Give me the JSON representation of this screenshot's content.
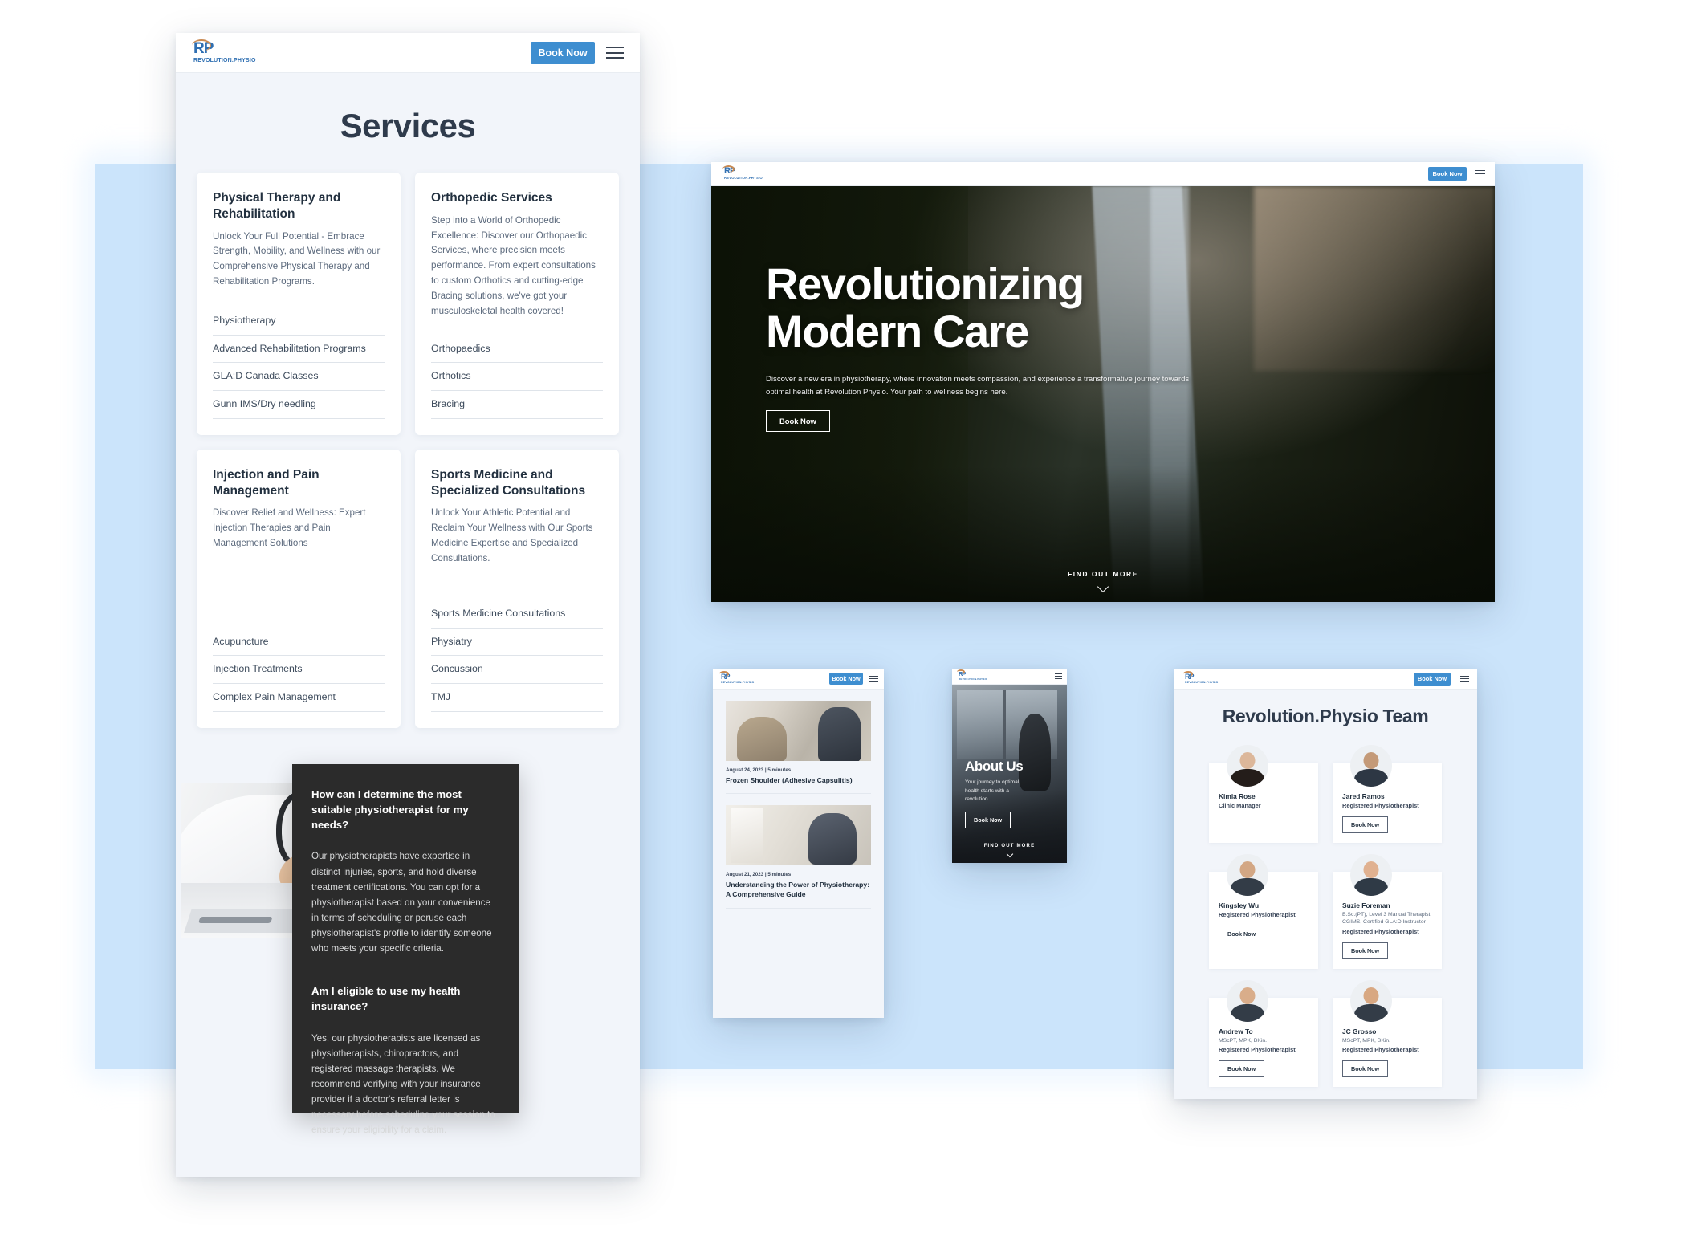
{
  "brand": {
    "mark": "RP",
    "wordmark": "REVOLUTION.PHYSIO",
    "accent": "#3e8ed0",
    "accent2": "#c98a52"
  },
  "common": {
    "book_now": "Book Now",
    "find_out_more": "FIND OUT MORE",
    "menu_icon": "hamburger-icon"
  },
  "services_page": {
    "title": "Services",
    "cards": [
      {
        "title": "Physical Therapy and Rehabilitation",
        "description": "Unlock Your Full Potential - Embrace Strength, Mobility, and Wellness with our Comprehensive Physical Therapy and Rehabilitation Programs.",
        "items": [
          "Physiotherapy",
          "Advanced Rehabilitation Programs",
          "GLA:D Canada Classes",
          "Gunn IMS/Dry needling"
        ]
      },
      {
        "title": "Orthopedic Services",
        "description": "Step into a World of Orthopedic Excellence: Discover our Orthopaedic Services, where precision meets performance. From expert consultations to custom Orthotics and cutting-edge Bracing solutions, we've got your musculoskeletal health covered!",
        "items": [
          "Orthopaedics",
          "Orthotics",
          "Bracing"
        ]
      },
      {
        "title": "Injection and Pain Management",
        "description": "Discover Relief and Wellness: Expert Injection Therapies and Pain Management Solutions",
        "items": [
          "Acupuncture",
          "Injection Treatments",
          "Complex Pain Management"
        ]
      },
      {
        "title": "Sports Medicine and Specialized Consultations",
        "description": "Unlock Your Athletic Potential and Reclaim Your Wellness with Our Sports Medicine Expertise and Specialized Consultations.",
        "items": [
          "Sports Medicine Consultations",
          "Physiatry",
          "Concussion",
          "TMJ"
        ]
      }
    ]
  },
  "faq": {
    "photo_alt": "doctor-at-desk-photo",
    "q1": "How can I determine the most suitable physiotherapist for my needs?",
    "a1": "Our physiotherapists have expertise in distinct injuries, sports, and hold diverse treatment certifications. You can opt for a physiotherapist based on your convenience in terms of scheduling or peruse each physiotherapist's profile to identify someone who meets your specific criteria.",
    "q2": "Am I eligible to use my health insurance?",
    "a2": "Yes, our physiotherapists are licensed as physiotherapists, chiropractors, and registered massage therapists. We recommend verifying with your insurance provider if a doctor's referral letter is necessary before scheduling your session to ensure your eligibility for a claim."
  },
  "hero": {
    "heading_line1": "Revolutionizing",
    "heading_line2": "Modern Care",
    "subtext": "Discover a new era in physiotherapy, where innovation meets compassion, and experience a transformative journey towards optimal health at Revolution Physio. Your path to wellness begins here.",
    "cta": "Book Now",
    "scroll_label": "FIND OUT MORE",
    "background_alt": "waterfall-forest-aerial-photo"
  },
  "blog": {
    "posts": [
      {
        "thumb_alt": "therapist-assisting-senior-with-resistance-band",
        "date": "August 24, 2023",
        "separator": "|",
        "read_time": "5 minutes",
        "title": "Frozen Shoulder (Adhesive Capsulitis)"
      },
      {
        "thumb_alt": "physiotherapy-treatment-session",
        "date": "August 21, 2023",
        "separator": "|",
        "read_time": "5 minutes",
        "title": "Understanding the Power of Physiotherapy: A Comprehensive Guide"
      }
    ]
  },
  "about": {
    "heading": "About Us",
    "subtext": "Your journey to optimal health starts with a revolution.",
    "cta": "Book Now",
    "scroll_label": "FIND OUT MORE",
    "background_alt": "clinic-gym-interior-photo"
  },
  "team": {
    "title": "Revolution.Physio Team",
    "members": [
      {
        "name": "Kimia Rose",
        "credentials": "",
        "role": "Clinic Manager",
        "cta": "",
        "avatar_alt": "kimia-rose-avatar",
        "hair": "#2b2320",
        "shirt": "#1f2733"
      },
      {
        "name": "Jared Ramos",
        "credentials": "",
        "role": "Registered Physiotherapist",
        "cta": "Book Now",
        "avatar_alt": "jared-ramos-avatar",
        "hair": "#1d1915",
        "shirt": "#2d3744"
      },
      {
        "name": "Kingsley Wu",
        "credentials": "",
        "role": "Registered Physiotherapist",
        "cta": "Book Now",
        "avatar_alt": "kingsley-wu-avatar",
        "hair": "#191512",
        "shirt": "#333c47"
      },
      {
        "name": "Suzie Foreman",
        "credentials": "B.Sc.(PT), Level 3 Manual Therapist, CGIMS, Certified GLA:D Instructor",
        "role": "Registered Physiotherapist",
        "cta": "Book Now",
        "avatar_alt": "suzie-foreman-avatar",
        "hair": "#5a3a22",
        "shirt": "#2f3a46"
      },
      {
        "name": "Andrew To",
        "credentials": "MScPT, MPK, BKin.",
        "role": "Registered Physiotherapist",
        "cta": "Book Now",
        "avatar_alt": "andrew-to-avatar",
        "hair": "#171310",
        "shirt": "#333c47"
      },
      {
        "name": "JC Grosso",
        "credentials": "MScPT, MPK, BKin.",
        "role": "Registered Physiotherapist",
        "cta": "Book Now",
        "avatar_alt": "jc-grosso-avatar",
        "hair": "#2a201a",
        "shirt": "#333c47"
      }
    ]
  }
}
